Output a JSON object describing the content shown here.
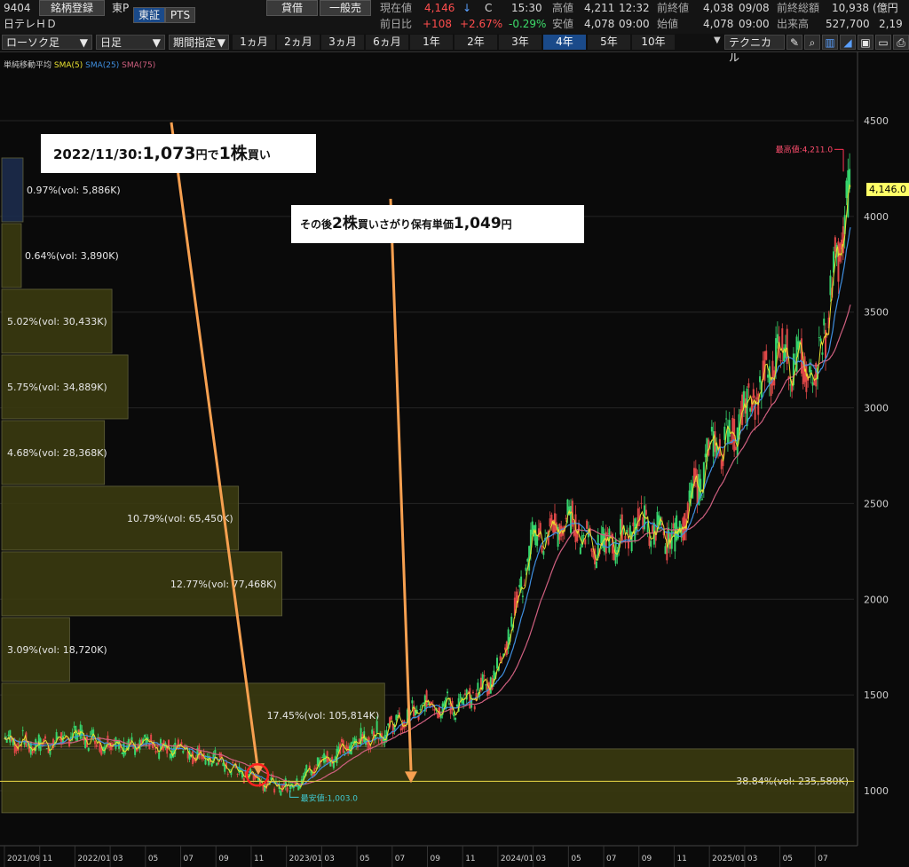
{
  "header": {
    "code": "9404",
    "register_btn": "銘柄登録",
    "market": "東P",
    "exchange_tab": "東証",
    "pts_tab": "PTS",
    "name": "日テレＨＤ",
    "lending": "貸借",
    "general_short": "一般売",
    "current_label": "現在値",
    "current_value": "4,146",
    "current_arrow": "↓",
    "current_flag": "C",
    "current_time": "15:30",
    "high_label": "高値",
    "high_value": "4,211",
    "high_time": "12:32",
    "prev_close_label": "前終値",
    "prev_close_value": "4,038",
    "prev_close_date": "09/08",
    "total_label": "前終総額",
    "total_value": "10,938",
    "total_unit": "(億円",
    "change_label": "前日比",
    "change_value": "+108",
    "change_pct": "+2.67%",
    "vwap_pct": "-0.29%",
    "low_label": "安値",
    "low_value": "4,078",
    "low_time": "09:00",
    "open_label": "始値",
    "open_value": "4,078",
    "open_time": "09:00",
    "volume_label": "出来高",
    "volume_value": "527,700",
    "volume_extra": "2,19"
  },
  "toolbar": {
    "chart_type": "ローソク足",
    "interval": "日足",
    "range_mode": "期間指定",
    "periods": [
      "1ヵ月",
      "2ヵ月",
      "3ヵ月",
      "6ヵ月",
      "1年",
      "2年",
      "3年",
      "4年",
      "5年",
      "10年"
    ],
    "active_period": "4年",
    "technical": "テクニカル"
  },
  "legend": {
    "title": "単純移動平均",
    "sma5": "SMA(5)",
    "sma25": "SMA(25)",
    "sma75": "SMA(75)"
  },
  "colors": {
    "sma5": "#e8e030",
    "sma25": "#3f8fe0",
    "sma75": "#d06080",
    "arrow": "#f7a050",
    "volume_profile": "#3a3a10",
    "bull": "#36d46c",
    "bear": "#e04848"
  },
  "annotations": {
    "callout1": {
      "pre": "2022/11/30:",
      "price": "1,073",
      "mid": "円で",
      "qty": "1株",
      "post": "買い"
    },
    "callout2": {
      "pre": "その後",
      "qty": "2株",
      "mid": "買いさがり保有単価",
      "price": "1,049",
      "post": "円"
    },
    "max_label": "最高値:4,211.0",
    "min_label": "最安値:1,003.0",
    "last_price": "4,146.0"
  },
  "chart_data": {
    "type": "candlestick",
    "y_ticks": [
      1000,
      1500,
      2000,
      2500,
      3000,
      3500,
      4000,
      4500
    ],
    "ylim": [
      880,
      4700
    ],
    "x_labels": [
      "2021/09",
      "11",
      "2022/01",
      "03",
      "05",
      "07",
      "09",
      "11",
      "2023/01",
      "03",
      "05",
      "07",
      "09",
      "11",
      "2024/01",
      "03",
      "05",
      "07",
      "09",
      "11",
      "2025/01",
      "03",
      "05",
      "07"
    ],
    "price_path": [
      [
        "2021-09",
        1270
      ],
      [
        "2021-11",
        1230
      ],
      [
        "2022-01",
        1290
      ],
      [
        "2022-03",
        1240
      ],
      [
        "2022-05",
        1230
      ],
      [
        "2022-07",
        1220
      ],
      [
        "2022-09",
        1150
      ],
      [
        "2022-11",
        1073
      ],
      [
        "2023-01",
        1010
      ],
      [
        "2023-03",
        1150
      ],
      [
        "2023-05",
        1250
      ],
      [
        "2023-07",
        1330
      ],
      [
        "2023-09",
        1450
      ],
      [
        "2023-11",
        1440
      ],
      [
        "2024-01",
        1620
      ],
      [
        "2024-03",
        2300
      ],
      [
        "2024-05",
        2400
      ],
      [
        "2024-07",
        2250
      ],
      [
        "2024-09",
        2400
      ],
      [
        "2024-11",
        2300
      ],
      [
        "2025-01",
        2750
      ],
      [
        "2025-03",
        2950
      ],
      [
        "2025-05",
        3300
      ],
      [
        "2025-07",
        3150
      ],
      [
        "2025-09",
        4146
      ]
    ],
    "volume_profile": [
      {
        "label": "0.97%(vol: 5,886K)",
        "pct": 0.97
      },
      {
        "label": "0.64%(vol: 3,890K)",
        "pct": 0.64
      },
      {
        "label": "5.02%(vol: 30,433K)",
        "pct": 5.02
      },
      {
        "label": "5.75%(vol: 34,889K)",
        "pct": 5.75
      },
      {
        "label": "4.68%(vol: 28,368K)",
        "pct": 4.68
      },
      {
        "label": "10.79%(vol: 65,450K)",
        "pct": 10.79
      },
      {
        "label": "12.77%(vol: 77,468K)",
        "pct": 12.77
      },
      {
        "label": "3.09%(vol: 18,720K)",
        "pct": 3.09
      },
      {
        "label": "17.45%(vol: 105,814K)",
        "pct": 17.45
      },
      {
        "label": "38.84%(vol: 235,580K)",
        "pct": 38.84
      }
    ],
    "holding_price": 1049,
    "max": 4211,
    "min": 1003,
    "last": 4146
  }
}
